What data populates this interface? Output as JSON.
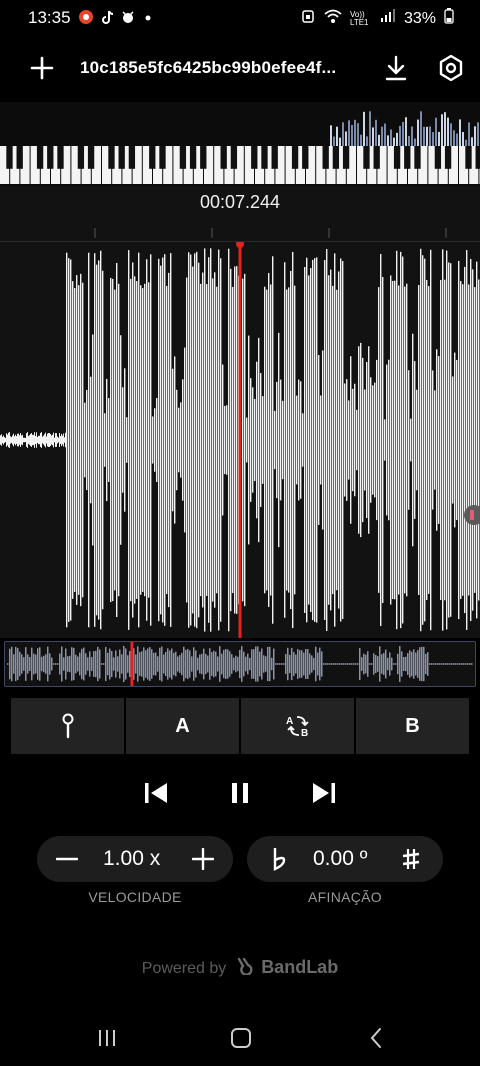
{
  "status_bar": {
    "time": "13:35",
    "notifications": [
      "recorder-badge-icon",
      "tiktok-icon",
      "bug-icon",
      "dot-icon"
    ],
    "battery": "33%",
    "signal_label": "Vo)) LTE1"
  },
  "top_bar": {
    "title": "10c185e5fc6425bc99b0efee4f..."
  },
  "timeline": {
    "timecode": "00:07.244"
  },
  "ab_bar": {
    "marker_label": "",
    "a_label": "A",
    "swap_label": "",
    "b_label": "B"
  },
  "speed": {
    "value": "1.00 x",
    "caption": "VELOCIDADE"
  },
  "pitch": {
    "value": "0.00 º",
    "caption": "AFINAÇÃO"
  },
  "footer": {
    "powered_prefix": "Powered by",
    "brand": "BandLab"
  },
  "playback": {
    "state": "playing",
    "playhead_fraction": 0.27
  },
  "colors": {
    "playhead": "#e02424",
    "waveform": "#f2f2f2",
    "overview_wave": "#8a94a6"
  }
}
